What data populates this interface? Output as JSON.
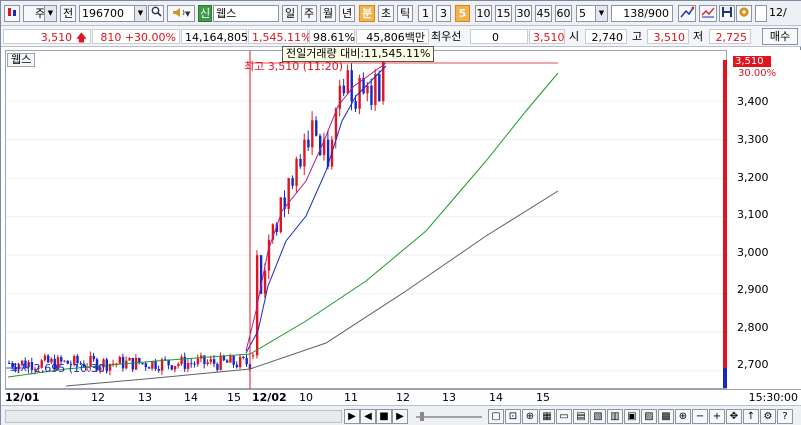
{
  "toolbar": {
    "market": "주",
    "prev_label": "전",
    "code": "196700",
    "new_badge": "신",
    "stock_name": "웹스",
    "periods": [
      "일",
      "주",
      "월",
      "년",
      "분",
      "초",
      "틱"
    ],
    "active_period": "분",
    "intervals": [
      "1",
      "3",
      "5",
      "10",
      "15",
      "30",
      "45",
      "60"
    ],
    "active_interval": "5",
    "interval_select": "5",
    "count": "138",
    "count_total": "/900",
    "cut_date": "12/"
  },
  "quote": {
    "price": "3,510",
    "change": "810",
    "change_pct": "+30.00%",
    "volume": "14,164,805",
    "volume_ratio": "1,545.11%",
    "strength": "98.61%",
    "amount": "45,806백만",
    "priority_label": "최우선",
    "priority_value": "0",
    "price2": "3,510",
    "open_label": "시",
    "open": "2,740",
    "high_label": "고",
    "high": "3,510",
    "low_label": "저",
    "low": "2,725",
    "sell_button": "매수"
  },
  "chart": {
    "series_label": "웹스",
    "tooltip": "전일거래량 대비:11,545.11%",
    "high_note": "최고 3,510 (11:20)",
    "low_note": "최저 2,695 (10:30)",
    "current_price_tag": "3,510",
    "current_pct_tag": "30.00%",
    "clock": "15:30:00"
  },
  "chart_data": {
    "type": "candlestick",
    "y_ticks": [
      "3,400",
      "3,300",
      "3,200",
      "3,100",
      "3,000",
      "2,900",
      "2,800",
      "2,700"
    ],
    "ylim": [
      2650,
      3530
    ],
    "x_ticks": [
      "12/01",
      "12",
      "13",
      "14",
      "15",
      "12/02",
      "10",
      "11",
      "12",
      "13",
      "14",
      "15"
    ],
    "colors": {
      "up": "#e0141e",
      "down": "#1428c8",
      "ma_fast": "#b0208c",
      "ma_mid": "#1428c8",
      "ma_slow": "#1a9a2a",
      "ma_long": "#606060"
    }
  }
}
